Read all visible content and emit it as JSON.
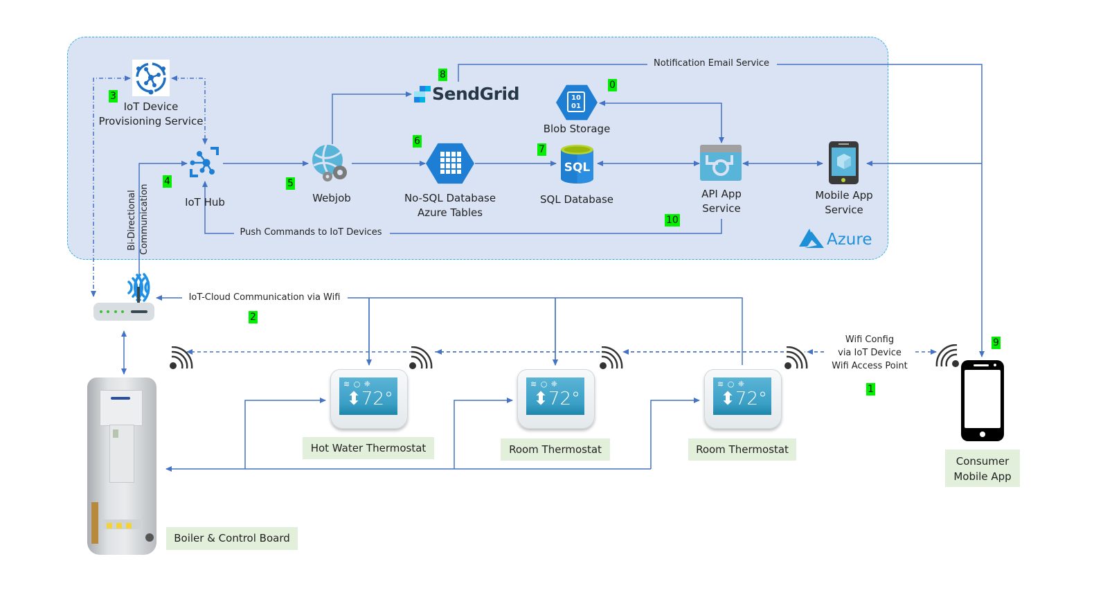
{
  "azure_panel": {
    "brand_label": "Azure"
  },
  "nodes": {
    "dps": {
      "label_line1": "IoT Device",
      "label_line2": "Provisioning Service",
      "badge": "3"
    },
    "iot_hub": {
      "label": "IoT Hub",
      "badge": "4"
    },
    "webjob": {
      "label": "Webjob",
      "badge": "5"
    },
    "sendgrid": {
      "label": "SendGrid",
      "badge": "8"
    },
    "blob": {
      "label": "Blob Storage",
      "badge": "0",
      "glyph": "10\n01"
    },
    "nosql": {
      "label_line1": "No-SQL Database",
      "label_line2": "Azure Tables",
      "badge": "6"
    },
    "sql": {
      "label": "SQL Database",
      "badge": "7",
      "glyph": "SQL"
    },
    "api_app": {
      "label_line1": "API App",
      "label_line2": "Service",
      "badge": "10"
    },
    "mobile_service": {
      "label_line1": "Mobile App",
      "label_line2": "Service"
    },
    "router": {
      "badge": "2"
    },
    "boiler": {
      "label": "Boiler & Control Board"
    },
    "thermostats": [
      {
        "label": "Hot Water Thermostat",
        "temp": "72°",
        "mode_icons": "≋ ○ ❈"
      },
      {
        "label": "Room Thermostat",
        "temp": "72°",
        "mode_icons": "≋ ○ ❈"
      },
      {
        "label": "Room Thermostat",
        "temp": "72°",
        "mode_icons": "≋ ○ ❈"
      }
    ],
    "consumer_app": {
      "label_line1": "Consumer",
      "label_line2": "Mobile App",
      "badge": "9"
    }
  },
  "connections": {
    "notification": "Notification Email Service",
    "push_commands": "Push Commands  to IoT Devices",
    "bidirectional_line1": "Bi-Directional",
    "bidirectional_line2": "Communication",
    "iot_cloud": "IoT-Cloud  Communication  via Wifi",
    "wifi_config_line1": "Wifi Config",
    "wifi_config_line2": "via IoT Device",
    "wifi_config_line3": "Wifi Access Point",
    "wifi_config_badge": "1"
  },
  "colors": {
    "line": "#4472c4",
    "panel": "#dae3f3",
    "panel_border": "#2ab0e8",
    "badge": "#00f000",
    "label_box": "#e2efda",
    "azure_blue": "#1e7ed4"
  }
}
